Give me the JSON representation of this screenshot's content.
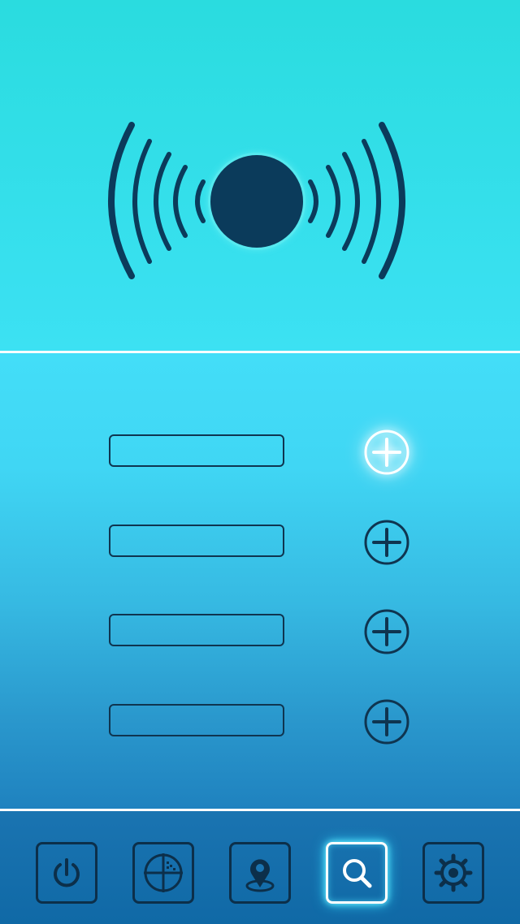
{
  "colors": {
    "icon_dark": "#0f3550",
    "active_glow": "#ffffff"
  },
  "beacon": {
    "icon": "broadcast-signal-icon"
  },
  "entries": [
    {
      "value": "",
      "add_icon": "plus-circle-icon",
      "highlighted": true
    },
    {
      "value": "",
      "add_icon": "plus-circle-icon",
      "highlighted": false
    },
    {
      "value": "",
      "add_icon": "plus-circle-icon",
      "highlighted": false
    },
    {
      "value": "",
      "add_icon": "plus-circle-icon",
      "highlighted": false
    }
  ],
  "nav": [
    {
      "icon": "power-icon",
      "active": false
    },
    {
      "icon": "radar-crosshair-icon",
      "active": false
    },
    {
      "icon": "map-pin-icon",
      "active": false
    },
    {
      "icon": "search-icon",
      "active": true
    },
    {
      "icon": "gear-icon",
      "active": false
    }
  ]
}
